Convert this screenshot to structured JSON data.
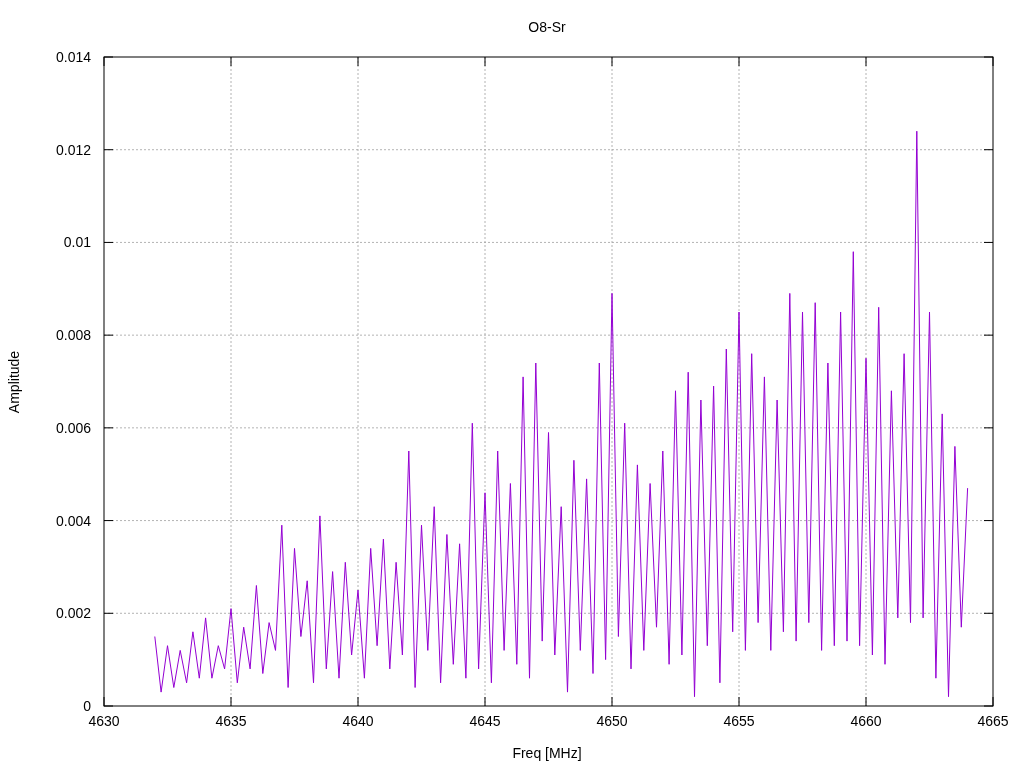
{
  "chart_data": {
    "type": "line",
    "title": "O8-Sr",
    "xlabel": "Freq [MHz]",
    "ylabel": "Amplitude",
    "xlim": [
      4630,
      4665
    ],
    "ylim": [
      0,
      0.014
    ],
    "grid": true,
    "xticks": [
      {
        "value": 4630,
        "label": "4630"
      },
      {
        "value": 4635,
        "label": "4635"
      },
      {
        "value": 4640,
        "label": "4640"
      },
      {
        "value": 4645,
        "label": "4645"
      },
      {
        "value": 4650,
        "label": "4650"
      },
      {
        "value": 4655,
        "label": "4655"
      },
      {
        "value": 4660,
        "label": "4660"
      },
      {
        "value": 4665,
        "label": "4665"
      }
    ],
    "yticks": [
      {
        "value": 0,
        "label": "0"
      },
      {
        "value": 0.002,
        "label": "0.002"
      },
      {
        "value": 0.004,
        "label": "0.004"
      },
      {
        "value": 0.006,
        "label": "0.006"
      },
      {
        "value": 0.008,
        "label": "0.008"
      },
      {
        "value": 0.01,
        "label": "0.01"
      },
      {
        "value": 0.012,
        "label": "0.012"
      },
      {
        "value": 0.014,
        "label": "0.014"
      }
    ],
    "x": [
      4632,
      4632.25,
      4632.5,
      4632.75,
      4633,
      4633.25,
      4633.5,
      4633.75,
      4634,
      4634.25,
      4634.5,
      4634.75,
      4635,
      4635.25,
      4635.5,
      4635.75,
      4636,
      4636.25,
      4636.5,
      4636.75,
      4637,
      4637.25,
      4637.5,
      4637.75,
      4638,
      4638.25,
      4638.5,
      4638.75,
      4639,
      4639.25,
      4639.5,
      4639.75,
      4640,
      4640.25,
      4640.5,
      4640.75,
      4641,
      4641.25,
      4641.5,
      4641.75,
      4642,
      4642.25,
      4642.5,
      4642.75,
      4643,
      4643.25,
      4643.5,
      4643.75,
      4644,
      4644.25,
      4644.5,
      4644.75,
      4645,
      4645.25,
      4645.5,
      4645.75,
      4646,
      4646.25,
      4646.5,
      4646.75,
      4647,
      4647.25,
      4647.5,
      4647.75,
      4648,
      4648.25,
      4648.5,
      4648.75,
      4649,
      4649.25,
      4649.5,
      4649.75,
      4650,
      4650.25,
      4650.5,
      4650.75,
      4651,
      4651.25,
      4651.5,
      4651.75,
      4652,
      4652.25,
      4652.5,
      4652.75,
      4653,
      4653.25,
      4653.5,
      4653.75,
      4654,
      4654.25,
      4654.5,
      4654.75,
      4655,
      4655.25,
      4655.5,
      4655.75,
      4656,
      4656.25,
      4656.5,
      4656.75,
      4657,
      4657.25,
      4657.5,
      4657.75,
      4658,
      4658.25,
      4658.5,
      4658.75,
      4659,
      4659.25,
      4659.5,
      4659.75,
      4660,
      4660.25,
      4660.5,
      4660.75,
      4661,
      4661.25,
      4661.5,
      4661.75,
      4662,
      4662.25,
      4662.5,
      4662.75,
      4663,
      4663.25,
      4663.5,
      4663.75,
      4664
    ],
    "series": [
      {
        "color": "#9400d3",
        "values": [
          0.0015,
          0.0003,
          0.0013,
          0.0004,
          0.0012,
          0.0005,
          0.0016,
          0.0006,
          0.0019,
          0.0006,
          0.0013,
          0.0008,
          0.0021,
          0.0005,
          0.0017,
          0.0008,
          0.0026,
          0.0007,
          0.0018,
          0.0012,
          0.0039,
          0.0004,
          0.0034,
          0.0015,
          0.0027,
          0.0005,
          0.0041,
          0.0008,
          0.0029,
          0.0006,
          0.0031,
          0.0011,
          0.0025,
          0.0006,
          0.0034,
          0.0013,
          0.0036,
          0.0008,
          0.0031,
          0.0011,
          0.0055,
          0.0004,
          0.0039,
          0.0012,
          0.0043,
          0.0005,
          0.0037,
          0.0009,
          0.0035,
          0.0006,
          0.0061,
          0.0008,
          0.0046,
          0.0005,
          0.0055,
          0.0012,
          0.0048,
          0.0009,
          0.0071,
          0.0006,
          0.0074,
          0.0014,
          0.0059,
          0.0011,
          0.0043,
          0.0003,
          0.0053,
          0.0012,
          0.0049,
          0.0007,
          0.0074,
          0.001,
          0.0089,
          0.0015,
          0.0061,
          0.0008,
          0.0052,
          0.0012,
          0.0048,
          0.0017,
          0.0055,
          0.0009,
          0.0068,
          0.0011,
          0.0072,
          0.0002,
          0.0066,
          0.0013,
          0.0069,
          0.0005,
          0.0077,
          0.0016,
          0.0085,
          0.0012,
          0.0076,
          0.0018,
          0.0071,
          0.0012,
          0.0066,
          0.0016,
          0.0089,
          0.0014,
          0.0085,
          0.0018,
          0.0087,
          0.0012,
          0.0074,
          0.0013,
          0.0085,
          0.0014,
          0.0098,
          0.0013,
          0.0075,
          0.0011,
          0.0086,
          0.0009,
          0.0068,
          0.0019,
          0.0076,
          0.0018,
          0.0124,
          0.0019,
          0.0085,
          0.0006,
          0.0063,
          0.0002,
          0.0056,
          0.0017,
          0.0047
        ]
      }
    ]
  }
}
